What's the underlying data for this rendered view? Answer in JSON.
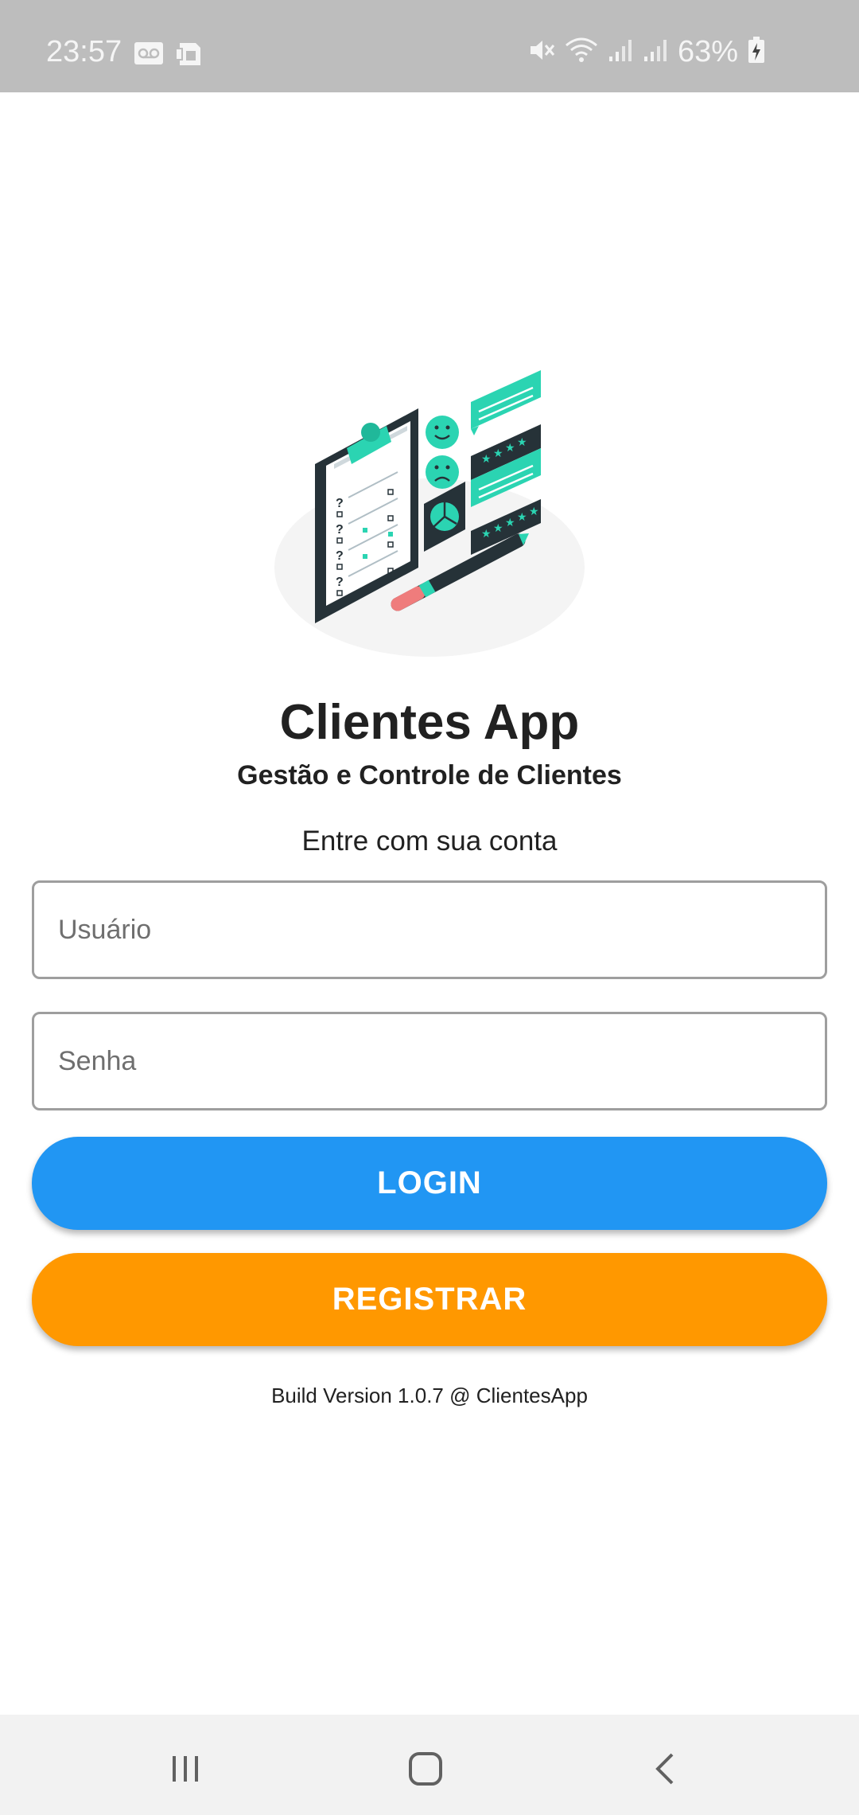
{
  "status_bar": {
    "time": "23:57",
    "battery_percent": "63%",
    "left_icons": [
      "voicemail-icon",
      "sim-card-icon"
    ],
    "right_icons": [
      "mute-icon",
      "wifi-icon",
      "signal-icon",
      "signal-icon-2",
      "battery-icon"
    ]
  },
  "app": {
    "title": "Clientes App",
    "subtitle": "Gestão e Controle de Clientes",
    "prompt": "Entre com sua conta"
  },
  "form": {
    "username_placeholder": "Usuário",
    "username_value": "",
    "password_placeholder": "Senha",
    "password_value": ""
  },
  "buttons": {
    "login_label": "LOGIN",
    "register_label": "REGISTRAR"
  },
  "footer": {
    "build": "Build Version 1.0.7 @ ClientesApp"
  },
  "nav_bar": {
    "icons": [
      "recent-apps-icon",
      "home-icon",
      "back-icon"
    ]
  },
  "colors": {
    "login_button": "#2196f3",
    "register_button": "#ff9800",
    "status_bar": "#bdbdbd",
    "accent_teal": "#2bd4b2",
    "illustration_dark": "#263238"
  }
}
